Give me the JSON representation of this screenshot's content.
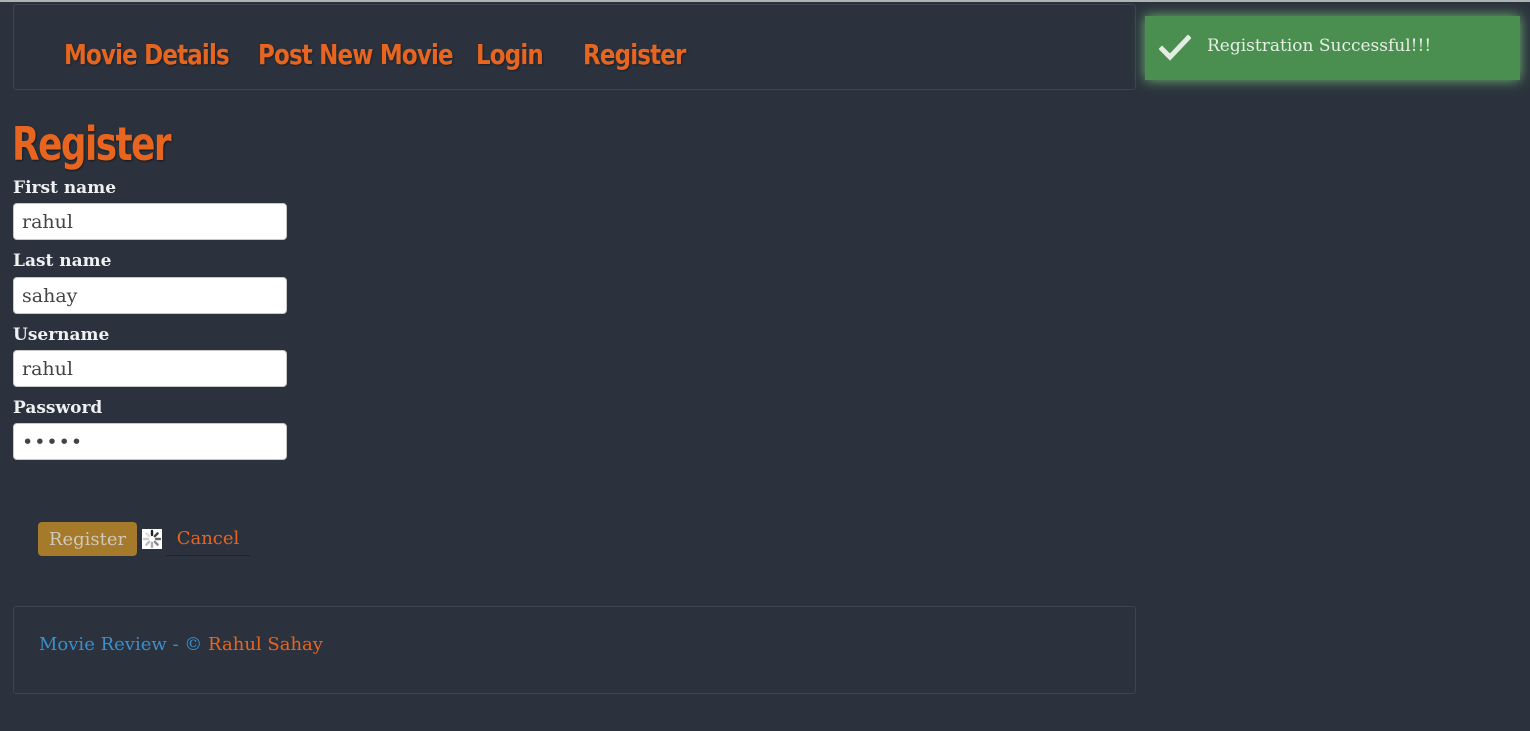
{
  "nav": {
    "items": [
      {
        "label": "Movie Details"
      },
      {
        "label": "Post New Movie"
      },
      {
        "label": "Login"
      },
      {
        "label": "Register"
      }
    ]
  },
  "page": {
    "title": "Register"
  },
  "form": {
    "first_name": {
      "label": "First name",
      "value": "rahul"
    },
    "last_name": {
      "label": "Last name",
      "value": "sahay"
    },
    "username": {
      "label": "Username",
      "value": "rahul"
    },
    "password": {
      "label": "Password",
      "value": "•••••"
    },
    "submit_label": "Register",
    "cancel_label": "Cancel",
    "spinner_icon": "loading-spinner-icon"
  },
  "footer": {
    "brand": "Movie Review - ©",
    "author": "Rahul Sahay"
  },
  "toast": {
    "message": "Registration Successful!!!",
    "icon": "checkmark-icon",
    "color": "#4a8f4f"
  },
  "colors": {
    "background": "#2b323d",
    "accent": "#e8651f",
    "link": "#3a8fcd",
    "button": "#a57a2a"
  }
}
